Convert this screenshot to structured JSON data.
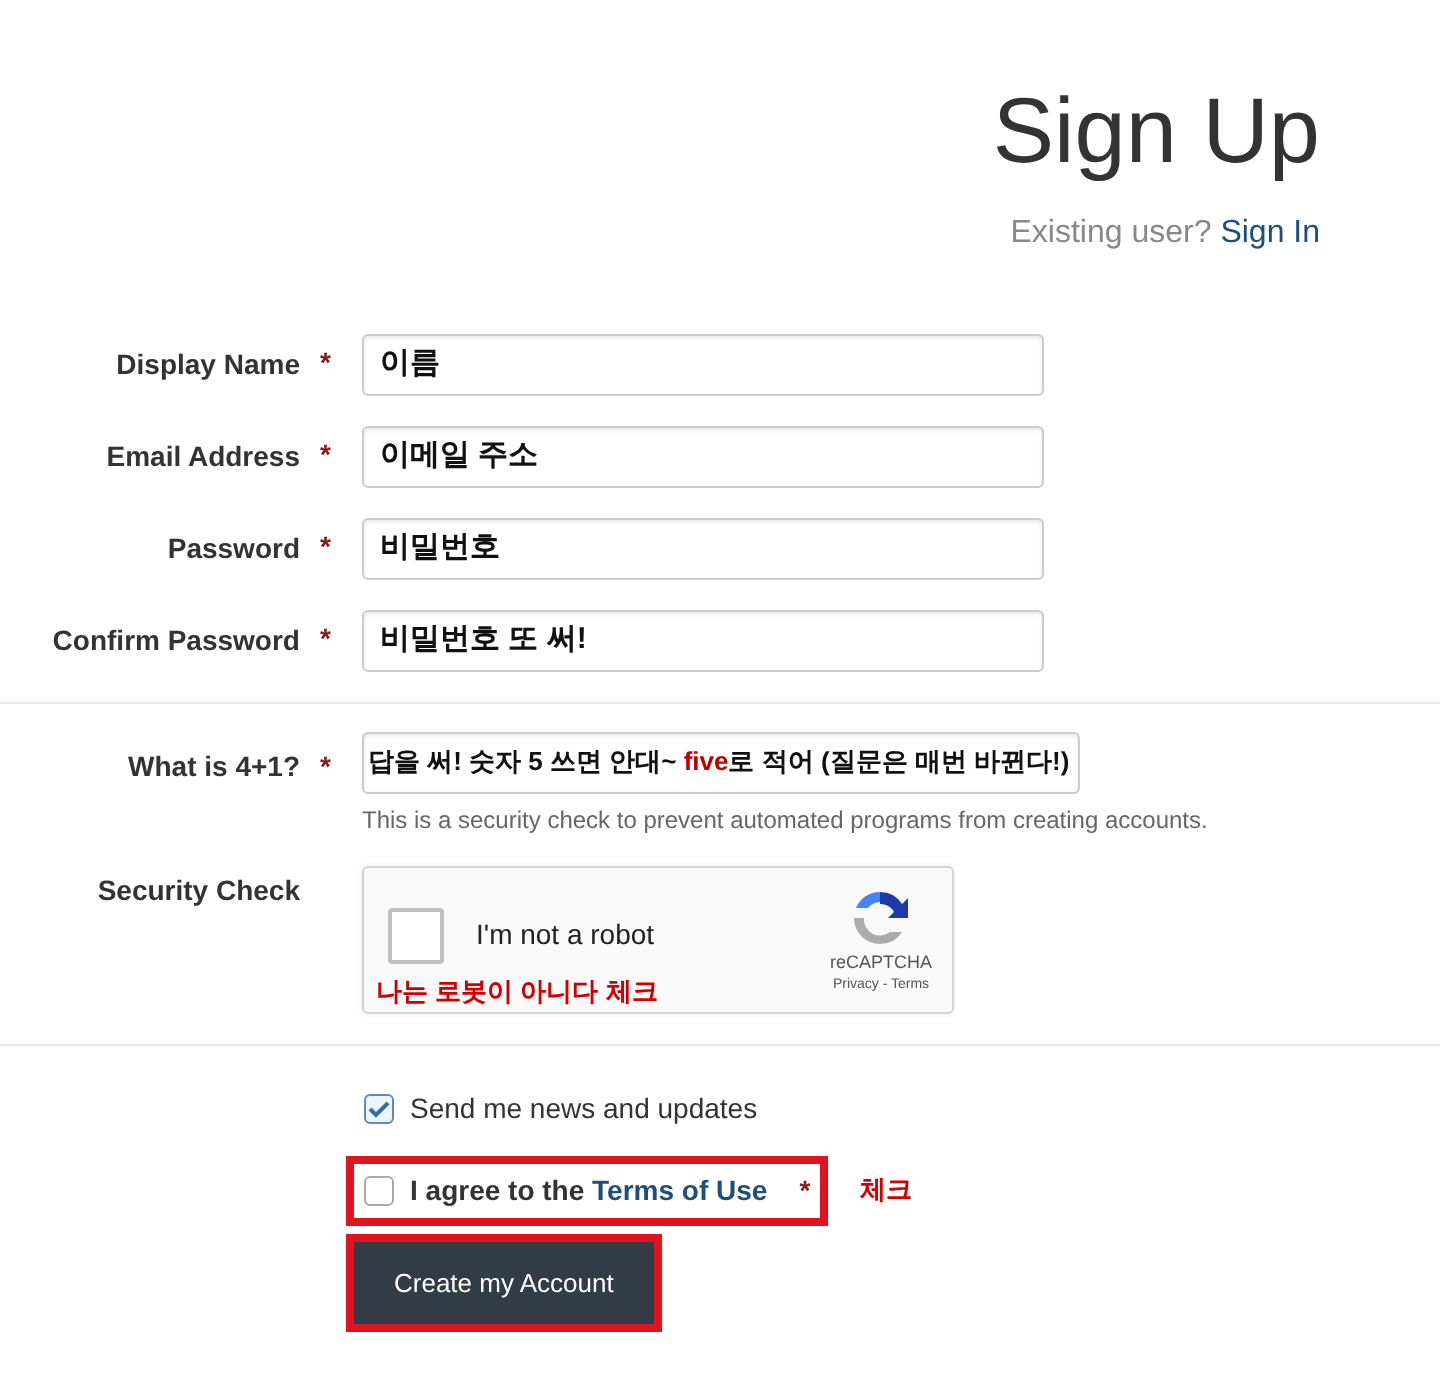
{
  "header": {
    "title": "Sign Up",
    "existing_prompt": "Existing user?",
    "sign_in_link": "Sign In"
  },
  "fields": [
    {
      "label": "Display Name",
      "required_mark": "*",
      "value": "이름"
    },
    {
      "label": "Email Address",
      "required_mark": "*",
      "value": "이메일 주소"
    },
    {
      "label": "Password",
      "required_mark": "*",
      "value": "비밀번호"
    },
    {
      "label": "Confirm Password",
      "required_mark": "*",
      "value": "비밀번호 또 써!"
    }
  ],
  "question": {
    "label": "What is 4+1?",
    "required_mark": "*",
    "answer_parts": [
      {
        "kind": "plain",
        "text": "답을 써! 숫자 5 쓰면 안대~ "
      },
      {
        "kind": "emphasis",
        "text": "five"
      },
      {
        "kind": "plain",
        "text": "로 적어 (질문은 매번 바뀐다!)"
      }
    ],
    "help": "This is a security check to prevent automated programs from creating accounts."
  },
  "security_check": {
    "label": "Security Check",
    "checked": false,
    "checkbox_label": "I'm not a robot",
    "annotation": "나는 로봇이 아니다 체크",
    "brand": "reCAPTCHA",
    "links": "Privacy - Terms"
  },
  "options": [
    {
      "kind": "newsletter",
      "label": "Send me news and updates",
      "checked": true,
      "highlighted": false
    },
    {
      "kind": "terms",
      "label": "I agree to the",
      "link": "Terms of Use",
      "checked": false,
      "required_mark": "*",
      "highlighted": true,
      "annotation": "체크"
    }
  ],
  "submit": {
    "label": "Create my Account",
    "highlighted": true
  }
}
